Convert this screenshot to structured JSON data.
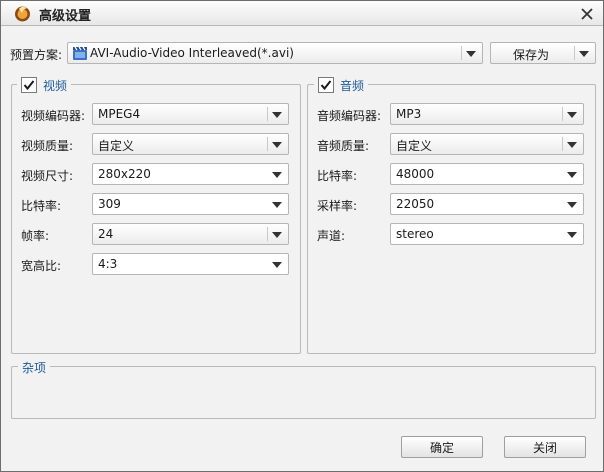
{
  "window": {
    "title": "高级设置",
    "close_glyph": "✕"
  },
  "preset": {
    "label": "预置方案:",
    "value": "AVI-Audio-Video Interleaved(*.avi)",
    "icon": "film-clapper-icon",
    "save_as_label": "保存为"
  },
  "video": {
    "group_title": "视频",
    "enabled": true,
    "rows": [
      {
        "label": "视频编码器:",
        "value": "MPEG4"
      },
      {
        "label": "视频质量:",
        "value": "自定义"
      },
      {
        "label": "视频尺寸:",
        "value": "280x220"
      },
      {
        "label": "比特率:",
        "value": "309"
      },
      {
        "label": "帧率:",
        "value": "24"
      },
      {
        "label": "宽高比:",
        "value": "4:3"
      }
    ]
  },
  "audio": {
    "group_title": "音频",
    "enabled": true,
    "rows": [
      {
        "label": "音频编码器:",
        "value": "MP3"
      },
      {
        "label": "音频质量:",
        "value": "自定义"
      },
      {
        "label": "比特率:",
        "value": "48000"
      },
      {
        "label": "采样率:",
        "value": "22050"
      },
      {
        "label": "声道:",
        "value": "stereo"
      }
    ]
  },
  "misc": {
    "group_title": "杂项"
  },
  "footer": {
    "ok_label": "确定",
    "close_label": "关闭"
  },
  "colors": {
    "accent_text": "#1f5a9a",
    "window_bg": "#f2f2f2"
  }
}
